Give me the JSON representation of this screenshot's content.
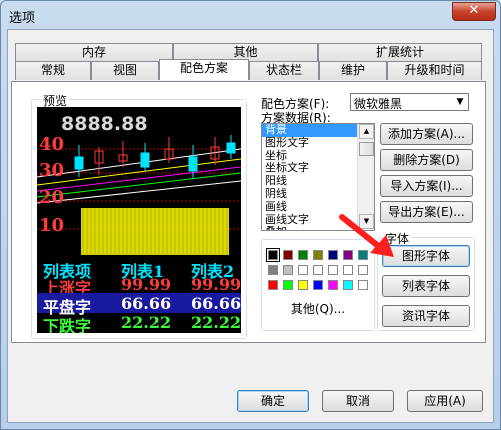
{
  "window": {
    "title": "选项",
    "close_label": "✕"
  },
  "tabs_back": [
    {
      "label": "内存"
    },
    {
      "label": "其他"
    },
    {
      "label": "扩展统计"
    }
  ],
  "tabs_front": [
    {
      "label": "常规"
    },
    {
      "label": "视图"
    },
    {
      "label": "配色方案"
    },
    {
      "label": "状态栏"
    },
    {
      "label": "维护"
    },
    {
      "label": "升级和时间"
    }
  ],
  "preview": {
    "group_label": "预览",
    "big_number": "8888.88",
    "y_labels": [
      "40",
      "30",
      "20",
      "10"
    ],
    "table": {
      "headers": [
        "列表项",
        "列表1",
        "列表2"
      ],
      "rows": [
        {
          "label": "上涨字",
          "v1": "99.99",
          "v2": "99.99"
        },
        {
          "label": "平盘字",
          "v1": "66.66",
          "v2": "66.66"
        },
        {
          "label": "下跌字",
          "v1": "22.22",
          "v2": "22.22"
        }
      ]
    },
    "colors": {
      "up": "#ff3c3c",
      "flat": "#ffffff",
      "down": "#3cff3c",
      "header": "#00e5ff",
      "selected_row_bg": "#1a1aa0",
      "volume": "#ffff00"
    }
  },
  "scheme": {
    "label": "配色方案(F):",
    "selected": "微软雅黑",
    "data_label": "方案数据(R):",
    "items": [
      "背景",
      "图形文字",
      "坐标",
      "坐标文字",
      "阳线",
      "阴线",
      "画线",
      "画线文字",
      "叠加"
    ],
    "selected_index": 0
  },
  "scheme_buttons": {
    "add": "添加方案(A)...",
    "delete": "删除方案(D)",
    "import": "导入方案(I)...",
    "export": "导出方案(E)..."
  },
  "font_group": {
    "label": "字体",
    "graphic_font": "图形字体",
    "list_font": "列表字体",
    "info_font": "资讯字体"
  },
  "palette": {
    "colors": [
      "#000000",
      "#800000",
      "#008000",
      "#808000",
      "#000080",
      "#800080",
      "#008080",
      "#808080",
      "#c0c0c0",
      "#ffffff",
      "#ffffff",
      "#ffffff",
      "#ffffff",
      "#ffffff",
      "#ff0000",
      "#00ff00",
      "#ffff00",
      "#0000ff",
      "#ff00ff",
      "#00ffff",
      "#ffffff"
    ],
    "selected_index": 0,
    "other_label": "其他(Q)..."
  },
  "footer": {
    "ok": "确定",
    "cancel": "取消",
    "apply": "应用(A)"
  }
}
